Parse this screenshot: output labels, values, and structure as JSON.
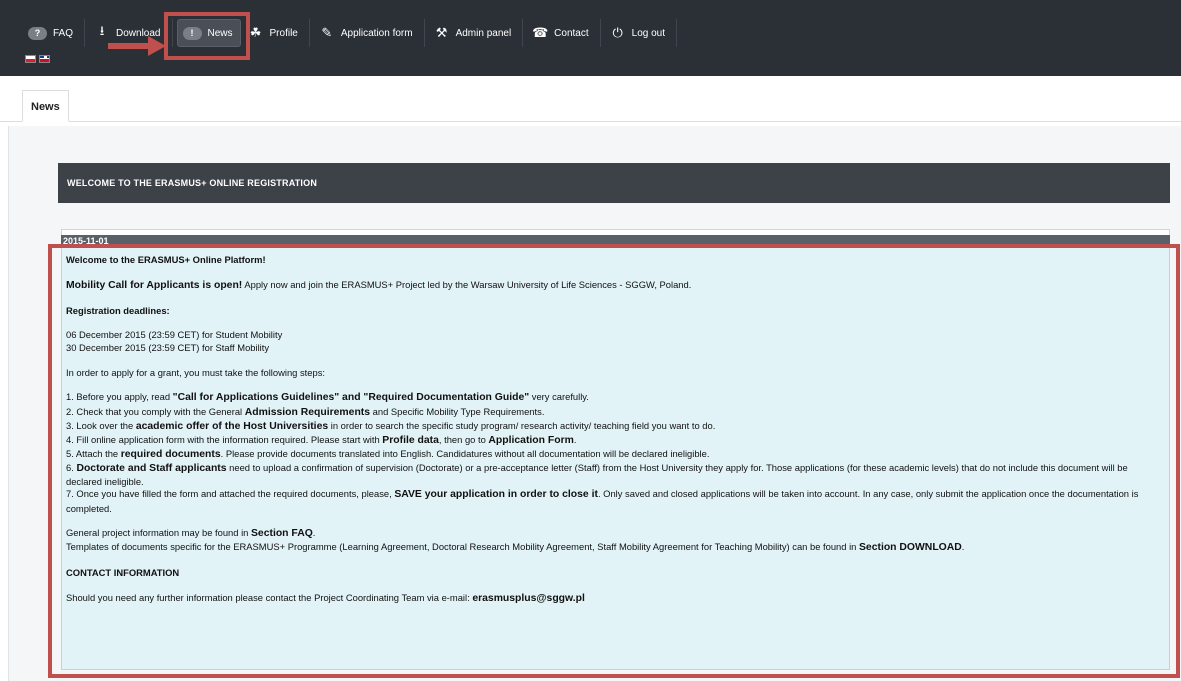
{
  "nav": {
    "items": [
      {
        "icon": "?",
        "label": "FAQ"
      },
      {
        "icon": "⭳",
        "label": "Download"
      },
      {
        "icon": "!",
        "label": "News"
      },
      {
        "icon": "☘",
        "label": "Profile"
      },
      {
        "icon": "✎",
        "label": "Application form"
      },
      {
        "icon": "⚒",
        "label": "Admin panel"
      },
      {
        "icon": "☎",
        "label": "Contact"
      },
      {
        "icon": "⏻",
        "label": "Log out"
      }
    ],
    "active": "News"
  },
  "languages": [
    "Polish",
    "English"
  ],
  "tab": {
    "label": "News"
  },
  "welcome_banner": "WELCOME TO THE ERASMUS+ ONLINE REGISTRATION",
  "news": {
    "date": "2015-11-01",
    "headline": "Welcome to the ERASMUS+ Online Platform!",
    "mobility_call": {
      "bold": "Mobility Call for Applicants is open!",
      "text": " Apply now and join the ERASMUS+ Project led by the Warsaw University of Life Sciences - SGGW, Poland."
    },
    "deadlines_title": "Registration deadlines:",
    "deadlines": [
      "06 December 2015 (23:59 CET) for Student Mobility",
      "30 December 2015 (23:59 CET) for Staff Mobility"
    ],
    "steps_intro": "In order to apply for a grant, you must take the following steps:",
    "steps": {
      "s1": {
        "a": "1. Before you apply, read ",
        "b": "\"Call for Applications Guidelines\" and \"Required Documentation Guide\"",
        "c": " very carefully."
      },
      "s2": {
        "a": "2. Check that you comply with the General ",
        "b": "Admission Requirements",
        "c": " and Specific Mobility Type Requirements."
      },
      "s3": {
        "a": "3. Look over the ",
        "b": "academic offer of the Host Universities",
        "c": " in order to search the specific study program/ research activity/ teaching field you want to do."
      },
      "s4": {
        "a": "4. Fill online application form with the information required. Please start with ",
        "b": "Profile data",
        "c": ", then go to ",
        "d": "Application Form",
        "e": "."
      },
      "s5": {
        "a": "5. Attach the ",
        "b": "required documents",
        "c": ". Please provide documents translated into English. Candidatures without all documentation will be declared ineligible."
      },
      "s6": {
        "a": "6. ",
        "b": "Doctorate and Staff applicants",
        "c": " need to upload a confirmation of supervision (Doctorate) or a pre-acceptance letter (Staff) from the Host University they apply for. Those applications (for these academic levels) that do not include this document will be declared ineligible."
      },
      "s7": {
        "a": "7. Once you have filled the form and attached the required documents, please, ",
        "b": "SAVE your application in order to close it",
        "c": ". Only saved and closed applications will be taken into account. In any case, only submit the application once the documentation is completed."
      }
    },
    "faq_line": {
      "a": "General project information may be found in ",
      "b": "Section FAQ",
      "c": "."
    },
    "templates_line": {
      "a": "Templates of documents specific for the ERASMUS+ Programme (Learning Agreement, Doctoral Research Mobility Agreement, Staff Mobility Agreement for Teaching Mobility) can be found in ",
      "b": "Section DOWNLOAD",
      "c": "."
    },
    "contact_title": "CONTACT INFORMATION",
    "contact_line": {
      "a": "Should you need any further information please contact the Project Coordinating Team via e-mail: ",
      "b": "erasmusplus@sggw.pl"
    }
  },
  "colors": {
    "topbar": "#2b2f36",
    "highlight": "#c0504d",
    "content_bg": "#e2f3f8",
    "banner": "#3d4148"
  }
}
